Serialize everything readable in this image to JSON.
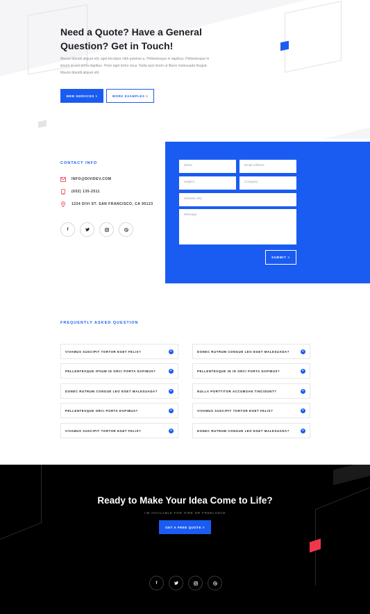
{
  "hero": {
    "title": "Need a Quote? Have a General Question? Get in Touch!",
    "body": "Mauris blandit aliquet elit, eget tincidunt nibh pulvinar a. Pellentesque in dapibus. Pellentesque in ipsum id orci porta dapibus. Proin eget tortor risus. Nulla quis lorem ut libero malesuada feugiat. Mauris blandit aliquet elit.",
    "primary_button": "WEB SERVICES >",
    "secondary_button": "WORK EXAMPLES >"
  },
  "contact": {
    "heading": "CONTACT INFO",
    "email": "INFO@DIVIDEV.COM",
    "phone": "(652) 135-2511",
    "address": "1234 DIVI ST. SAN FRANCISCO, CA 95123",
    "social": [
      "f",
      "t",
      "ig",
      "@"
    ]
  },
  "form": {
    "name_placeholder": "Name",
    "email_placeholder": "Email Address",
    "subject_placeholder": "Subject",
    "company_placeholder": "Company",
    "website_placeholder": "Website URL",
    "message_placeholder": "Message",
    "submit_label": "SUBMIT >"
  },
  "faq": {
    "heading": "FREQUENTLY ASKED QUESTION",
    "left": [
      "VIVAMUS SUSCIPIT TORTOR EGET FELIS?",
      "PELLENTESQUE IPSUM ID ORCI PORTA DAPIBUS?",
      "DONEC RUTRUM CONGUE LEO EGET MALESUADA?",
      "PELLENTESQUE ORCI PORTA DAPIBUS?",
      "VIVAMUS SUSCIPIT TORTOR EGET FELIS?"
    ],
    "right": [
      "DONEC RUTRUM CONGUE LEO EGET MALESUADA?",
      "PELLENTESQUE IN ID ORCI PORTA DAPIBUS?",
      "NULLA PORTTITOR ACCUMSAN TINCIDUNT?",
      "VIVAMUS SUSCIPIT TORTOR EGET FELIS?",
      "DONEC RUTRUM CONGUE LEO EGET MALESUADA?"
    ]
  },
  "footer": {
    "title": "Ready to Make Your Idea Come to Life?",
    "subtitle": "I'M AVAILABLE FOR HIRE OR FREELANCE",
    "cta": "GET A FREE QUOTE >",
    "social": [
      "f",
      "t",
      "ig",
      "@"
    ]
  },
  "colors": {
    "accent": "#1a5cf2",
    "footer_bg": "#000000",
    "red_accent": "#f2364a"
  },
  "icons": {
    "email": "envelope-icon",
    "phone": "phone-icon",
    "address": "map-pin-icon"
  }
}
